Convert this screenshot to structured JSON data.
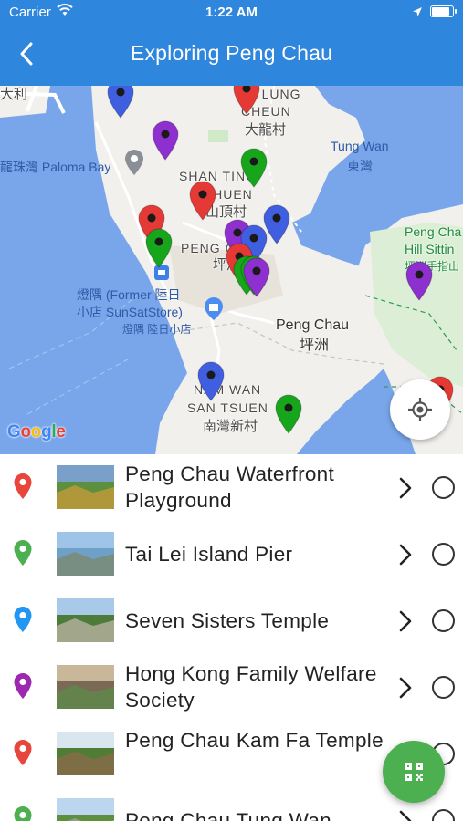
{
  "status_bar": {
    "carrier": "Carrier",
    "time": "1:22 AM",
    "battery_fraction": 0.92
  },
  "header": {
    "title": "Exploring Peng Chau",
    "back_icon": "chevron-left-icon"
  },
  "map": {
    "labels": {
      "tai_lei_partial": "大利",
      "tai_lung_en": "TAI LUNG",
      "tai_lung_en2": "CHEUN",
      "tai_lung_zh": "大龍村",
      "tung_wan_en": "Tung Wan",
      "tung_wan_zh": "東灣",
      "paloma_bay": "龍珠灣 Paloma Bay",
      "shan_ting_en": "SHAN TING",
      "shan_ting_en2": "CHUEN",
      "shan_ting_zh": "山頂村",
      "peng_chau_town_en": "PENG CHAU",
      "peng_chau_town_zh": "坪洲",
      "former_store_1": "燈隅 (Former 陸日",
      "former_store_2": "小店 SunSatStore)",
      "former_store_3": "燈隅 陸日小店",
      "peng_chau_en": "Peng Chau",
      "peng_chau_zh": "坪洲",
      "hill_1": "Peng Cha",
      "hill_2": "Hill Sittin",
      "hill_3": "坪洲手指山",
      "nam_wan_en": "NAM WAN",
      "nam_wan_en2": "SAN TSUEN",
      "nam_wan_zh": "南灣新村"
    },
    "attribution": [
      "G",
      "o",
      "o",
      "g",
      "l",
      "e"
    ],
    "locate_button_icon": "my-location-icon",
    "colors": {
      "red": "#e53935",
      "green": "#17a51c",
      "blue": "#3f5fe0",
      "purple": "#8e2fcf",
      "water": "#79a6ea",
      "land": "#f2f0ec"
    }
  },
  "places": [
    {
      "title": "Peng Chau Waterfront Playground",
      "pin_color": "#e8453c",
      "pin_icon": "map-pin-icon"
    },
    {
      "title": "Tai Lei Island Pier",
      "pin_color": "#4caf50",
      "pin_icon": "map-pin-icon"
    },
    {
      "title": "Seven Sisters Temple",
      "pin_color": "#2196f3",
      "pin_icon": "map-pin-icon"
    },
    {
      "title": "Hong Kong Family Welfare Society",
      "pin_color": "#9c27b0",
      "pin_icon": "map-pin-icon"
    },
    {
      "title": "Peng Chau Kam Fa Temple",
      "pin_color": "#e8453c",
      "pin_icon": "map-pin-icon"
    },
    {
      "title": "Peng Chau Tung Wan",
      "pin_color": "#4caf50",
      "pin_icon": "map-pin-icon"
    }
  ],
  "fab": {
    "icon": "qr-code-icon"
  }
}
